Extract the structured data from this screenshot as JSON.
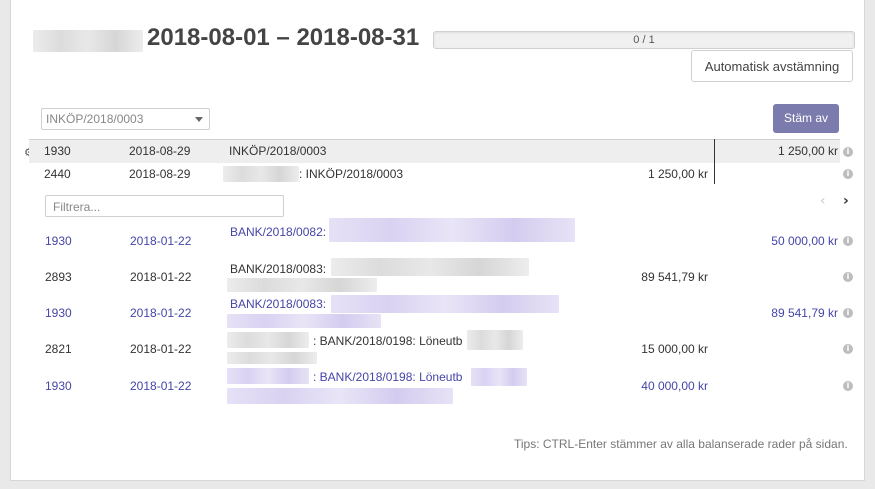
{
  "header": {
    "period": "2018-08-01 – 2018-08-31",
    "progress_text": "0 / 1",
    "auto_button": "Automatisk avstämning"
  },
  "toolbar": {
    "select_value": "INKÖP/2018/0003",
    "reconcile_button": "Stäm av"
  },
  "selected_lines": [
    {
      "account": "1930",
      "date": "2018-08-29",
      "label": "INKÖP/2018/0003",
      "debit": "",
      "credit": "1 250,00 kr"
    },
    {
      "account": "2440",
      "date": "2018-08-29",
      "label": ": INKÖP/2018/0003",
      "debit": "1 250,00 kr",
      "credit": ""
    }
  ],
  "filter": {
    "placeholder": "Filtrera...",
    "value": ""
  },
  "proposals": [
    {
      "account": "1930",
      "date": "2018-01-22",
      "label": "BANK/2018/0082:",
      "debit": "",
      "credit": "50 000,00 kr",
      "highlight": true
    },
    {
      "account": "2893",
      "date": "2018-01-22",
      "label": "BANK/2018/0083:",
      "debit": "89 541,79 kr",
      "credit": "",
      "highlight": false
    },
    {
      "account": "1930",
      "date": "2018-01-22",
      "label": "BANK/2018/0083:",
      "debit": "",
      "credit": "89 541,79 kr",
      "highlight": true
    },
    {
      "account": "2821",
      "date": "2018-01-22",
      "label": ": BANK/2018/0198: Löneutb",
      "debit": "15 000,00 kr",
      "credit": "",
      "highlight": false
    },
    {
      "account": "1930",
      "date": "2018-01-22",
      "label": ": BANK/2018/0198: Löneutb",
      "debit": "40 000,00 kr",
      "credit": "",
      "highlight": true
    }
  ],
  "tips": "Tips: CTRL-Enter stämmer av alla balanserade rader på sidan.",
  "colors": {
    "accent": "#7c7bad",
    "link": "#4545a8",
    "selected_row": "#eeeeee"
  },
  "icons": {
    "row_action": "gear-icon",
    "row_info": "info-icon",
    "prev": "chevron-left-icon",
    "next": "chevron-right-icon"
  }
}
